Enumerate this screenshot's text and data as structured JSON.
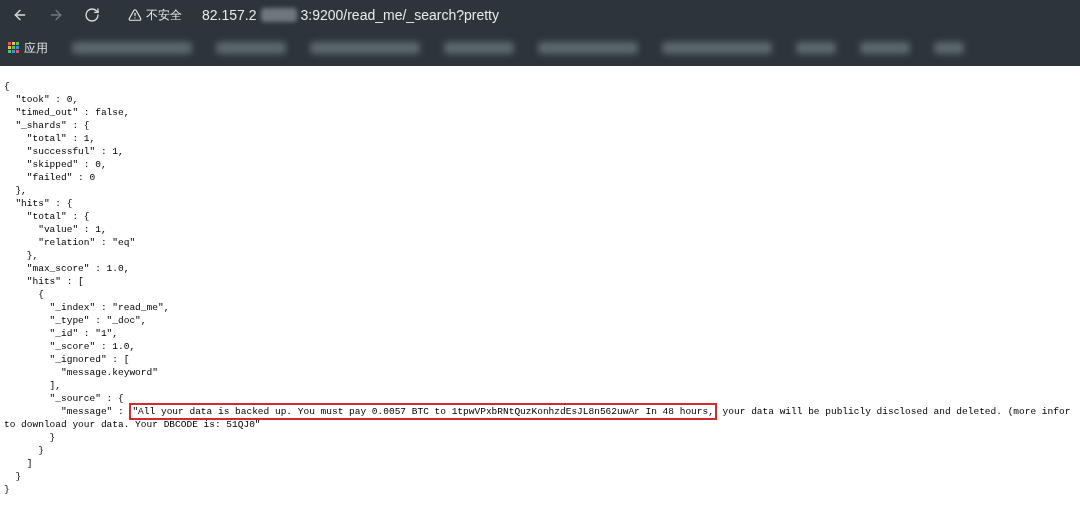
{
  "browser": {
    "security_label": "不安全",
    "url_start": "82.157.2",
    "url_end": "3:9200/read_me/_search?pretty",
    "apps_label": "应用"
  },
  "lines": [
    {
      "kind": "plain",
      "text": "{"
    },
    {
      "kind": "plain",
      "text": "  \"took\" : 0,"
    },
    {
      "kind": "plain",
      "text": "  \"timed_out\" : false,"
    },
    {
      "kind": "plain",
      "text": "  \"_shards\" : {"
    },
    {
      "kind": "plain",
      "text": "    \"total\" : 1,"
    },
    {
      "kind": "plain",
      "text": "    \"successful\" : 1,"
    },
    {
      "kind": "plain",
      "text": "    \"skipped\" : 0,"
    },
    {
      "kind": "plain",
      "text": "    \"failed\" : 0"
    },
    {
      "kind": "plain",
      "text": "  },"
    },
    {
      "kind": "plain",
      "text": "  \"hits\" : {"
    },
    {
      "kind": "plain",
      "text": "    \"total\" : {"
    },
    {
      "kind": "plain",
      "text": "      \"value\" : 1,"
    },
    {
      "kind": "plain",
      "text": "      \"relation\" : \"eq\""
    },
    {
      "kind": "plain",
      "text": "    },"
    },
    {
      "kind": "plain",
      "text": "    \"max_score\" : 1.0,"
    },
    {
      "kind": "plain",
      "text": "    \"hits\" : ["
    },
    {
      "kind": "plain",
      "text": "      {"
    },
    {
      "kind": "plain",
      "text": "        \"_index\" : \"read_me\","
    },
    {
      "kind": "plain",
      "text": "        \"_type\" : \"_doc\","
    },
    {
      "kind": "plain",
      "text": "        \"_id\" : \"1\","
    },
    {
      "kind": "plain",
      "text": "        \"_score\" : 1.0,"
    },
    {
      "kind": "plain",
      "text": "        \"_ignored\" : ["
    },
    {
      "kind": "plain",
      "text": "          \"message.keyword\""
    },
    {
      "kind": "plain",
      "text": "        ],"
    },
    {
      "kind": "plain",
      "text": "        \"_source\" : {"
    },
    {
      "kind": "highlighted",
      "text": "          \"message\" : ",
      "highlight": "\"All your data is backed up. You must pay 0.0057 BTC to 1tpwVPxbRNtQuzKonhzdEsJL8n562uwAr In 48 hours,",
      "rest": " your data will be publicly disclosed and deleted. (more infor"
    },
    {
      "kind": "plain",
      "text": "to download your data. Your DBCODE is: 51QJ0\""
    },
    {
      "kind": "plain",
      "text": "        }"
    },
    {
      "kind": "plain",
      "text": "      }"
    },
    {
      "kind": "plain",
      "text": "    ]"
    },
    {
      "kind": "plain",
      "text": "  }"
    },
    {
      "kind": "plain",
      "text": "}"
    }
  ]
}
